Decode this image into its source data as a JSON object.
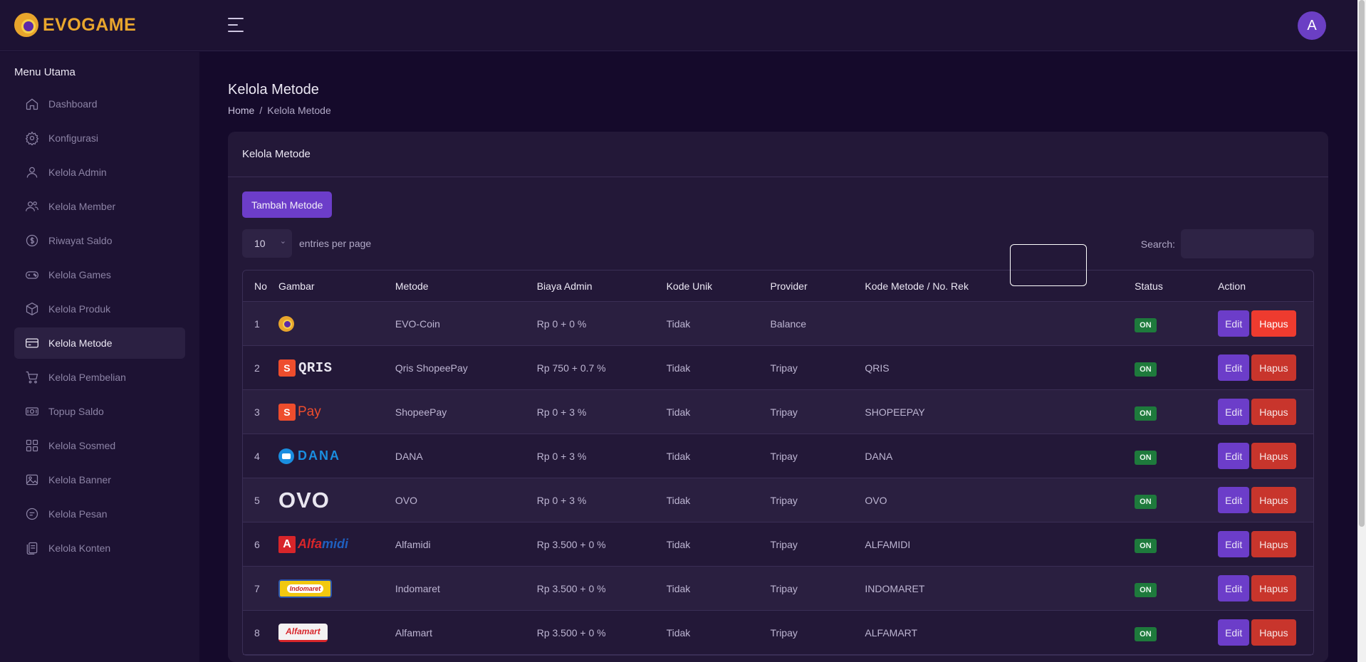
{
  "brand": {
    "name": "EVOGAME"
  },
  "topbar": {
    "avatar_letter": "A"
  },
  "sidebar": {
    "title": "Menu Utama",
    "items": [
      {
        "label": "Dashboard",
        "icon": "home-icon",
        "active": false
      },
      {
        "label": "Konfigurasi",
        "icon": "gear-icon",
        "active": false
      },
      {
        "label": "Kelola Admin",
        "icon": "user-icon",
        "active": false
      },
      {
        "label": "Kelola Member",
        "icon": "users-icon",
        "active": false
      },
      {
        "label": "Riwayat Saldo",
        "icon": "dollar-circle-icon",
        "active": false
      },
      {
        "label": "Kelola Games",
        "icon": "gamepad-icon",
        "active": false
      },
      {
        "label": "Kelola Produk",
        "icon": "box-icon",
        "active": false
      },
      {
        "label": "Kelola Metode",
        "icon": "credit-card-icon",
        "active": true
      },
      {
        "label": "Kelola Pembelian",
        "icon": "cart-icon",
        "active": false
      },
      {
        "label": "Topup Saldo",
        "icon": "money-icon",
        "active": false
      },
      {
        "label": "Kelola Sosmed",
        "icon": "grid-icon",
        "active": false
      },
      {
        "label": "Kelola Banner",
        "icon": "image-icon",
        "active": false
      },
      {
        "label": "Kelola Pesan",
        "icon": "chat-icon",
        "active": false
      },
      {
        "label": "Kelola Konten",
        "icon": "document-icon",
        "active": false
      }
    ]
  },
  "page": {
    "title": "Kelola Metode",
    "breadcrumb": {
      "home": "Home",
      "separator": "/",
      "current": "Kelola Metode"
    }
  },
  "card": {
    "title": "Kelola Metode",
    "add_button": "Tambah Metode",
    "entries": {
      "value": "10",
      "label": "entries per page"
    },
    "search_label": "Search:",
    "search_value": ""
  },
  "table": {
    "headers": [
      "No",
      "Gambar",
      "Metode",
      "Biaya Admin",
      "Kode Unik",
      "Provider",
      "Kode Metode / No. Rek",
      "Status",
      "Action"
    ],
    "rows": [
      {
        "no": "1",
        "logo": "evo-coin-logo",
        "metode": "EVO-Coin",
        "biaya": "Rp 0 + 0 %",
        "kode_unik": "Tidak",
        "provider": "Balance",
        "kode": "",
        "status": "ON"
      },
      {
        "no": "2",
        "logo": "qris-shopeepay-logo",
        "metode": "Qris ShopeePay",
        "biaya": "Rp 750 + 0.7 %",
        "kode_unik": "Tidak",
        "provider": "Tripay",
        "kode": "QRIS",
        "status": "ON"
      },
      {
        "no": "3",
        "logo": "shopeepay-logo",
        "metode": "ShopeePay",
        "biaya": "Rp 0 + 3 %",
        "kode_unik": "Tidak",
        "provider": "Tripay",
        "kode": "SHOPEEPAY",
        "status": "ON"
      },
      {
        "no": "4",
        "logo": "dana-logo",
        "metode": "DANA",
        "biaya": "Rp 0 + 3 %",
        "kode_unik": "Tidak",
        "provider": "Tripay",
        "kode": "DANA",
        "status": "ON"
      },
      {
        "no": "5",
        "logo": "ovo-logo",
        "metode": "OVO",
        "biaya": "Rp 0 + 3 %",
        "kode_unik": "Tidak",
        "provider": "Tripay",
        "kode": "OVO",
        "status": "ON"
      },
      {
        "no": "6",
        "logo": "alfamidi-logo",
        "metode": "Alfamidi",
        "biaya": "Rp 3.500 + 0 %",
        "kode_unik": "Tidak",
        "provider": "Tripay",
        "kode": "ALFAMIDI",
        "status": "ON"
      },
      {
        "no": "7",
        "logo": "indomaret-logo",
        "metode": "Indomaret",
        "biaya": "Rp 3.500 + 0 %",
        "kode_unik": "Tidak",
        "provider": "Tripay",
        "kode": "INDOMARET",
        "status": "ON"
      },
      {
        "no": "8",
        "logo": "alfamart-logo",
        "metode": "Alfamart",
        "biaya": "Rp 3.500 + 0 %",
        "kode_unik": "Tidak",
        "provider": "Tripay",
        "kode": "ALFAMART",
        "status": "ON"
      }
    ],
    "edit_label": "Edit",
    "delete_label": "Hapus",
    "logo_text": {
      "shopee_s": "S",
      "qris": "QRIS",
      "pay": "Pay",
      "dana": "DANA",
      "ovo": "OVO",
      "alfamidi_a": "A",
      "alfa": "Alfa",
      "midi": "midi",
      "indomaret": "Indomaret",
      "alfamart": "Alfamart"
    }
  },
  "colors": {
    "background": "#150a2b",
    "surface": "#231838",
    "accent": "#6c3dc9",
    "danger": "#c8352c",
    "success": "#1e7a3c",
    "brand": "#e9a62d"
  }
}
